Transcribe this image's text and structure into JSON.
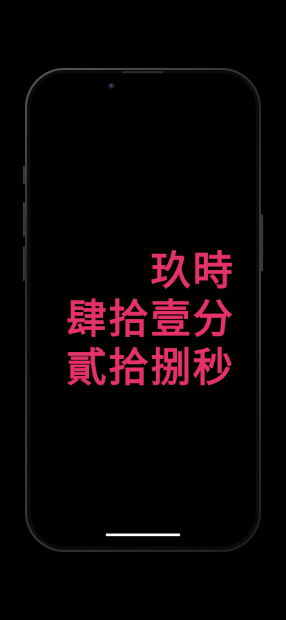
{
  "clock": {
    "hour": "玖時",
    "minute": "肆拾壹分",
    "second": "貳拾捌秒"
  },
  "colors": {
    "background": "#000000",
    "text": "#e5336a",
    "home_indicator": "#ffffff"
  },
  "icons": {
    "camera": "front-camera-icon",
    "speaker": "earpiece-speaker-icon"
  }
}
